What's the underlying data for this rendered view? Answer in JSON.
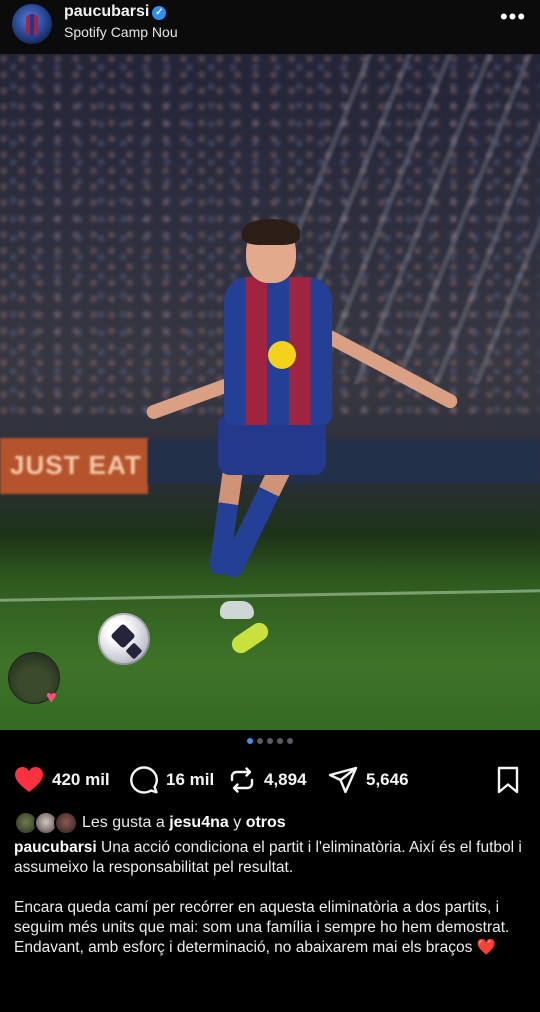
{
  "header": {
    "username": "paucubarsi",
    "verified_mark": "✓",
    "location": "Spotify Camp Nou",
    "more_icon": "•••"
  },
  "photo": {
    "adboard_text": "JUST EAT",
    "collab_heart": "♥"
  },
  "carousel": {
    "count": 5,
    "active": 1
  },
  "actions": {
    "likes": "420 mil",
    "comments": "16 mil",
    "reposts": "4,894",
    "shares": "5,646"
  },
  "liked_by": {
    "prefix": "Les gusta a",
    "user": "jesu4na",
    "connector": "y",
    "others": "otros"
  },
  "caption": {
    "user": "paucubarsi",
    "line1": "Una acció condiciona el partit i l'eliminatòria. Així és el futbol i assumeixo la responsabilitat pel resultat.",
    "line2": "Encara queda camí per recórrer en aquesta eliminatòria a dos partits, i seguim més units que mai: som una família i sempre ho hem demostrat.",
    "line3": "Endavant, amb esforç i determinació, no abaixarem mai els braços",
    "emoji": "❤️"
  },
  "colors": {
    "heart": "#ff3040",
    "verified": "#2f8ff0",
    "active_dot": "#3f8ef2"
  }
}
